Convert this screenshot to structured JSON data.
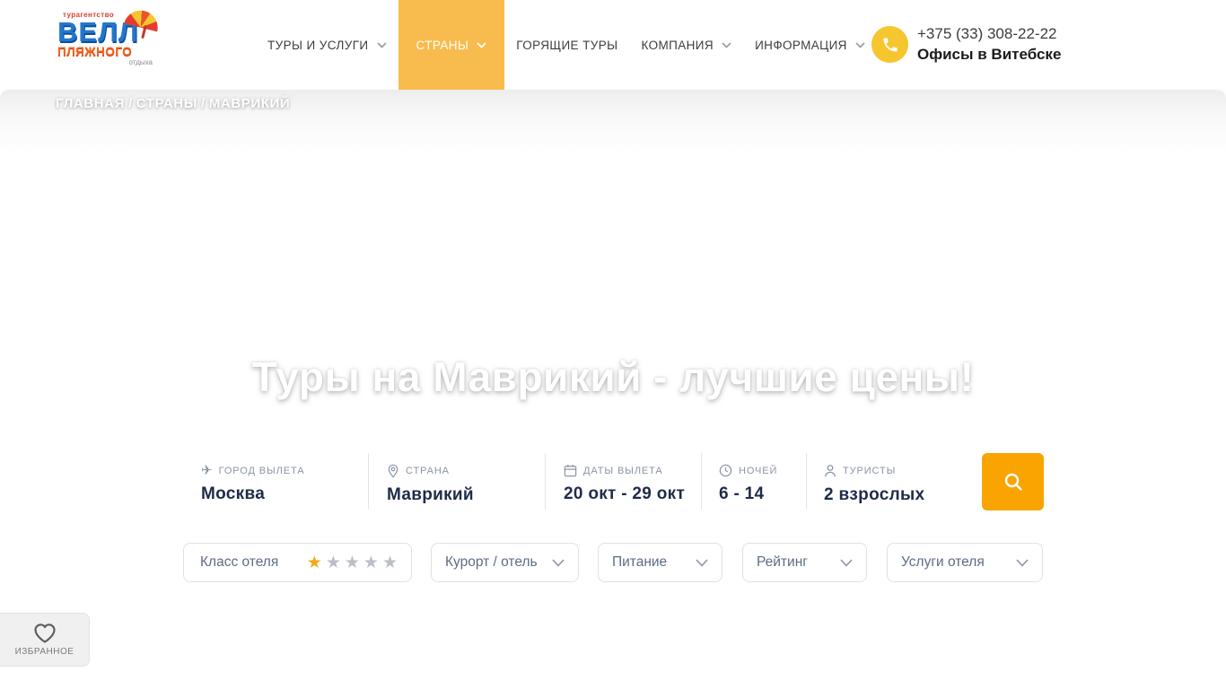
{
  "colors": {
    "accent_yellow": "#F8BC4E",
    "accent_orange": "#F9A400",
    "phone_circle_yellow": "#F6C62E",
    "star_active": "#F5A71B",
    "value_navy": "#1F2B49",
    "label_gray_blue": "#8A94A6"
  },
  "header": {
    "logo": {
      "agency": "турагентство",
      "brand": "ВЕЛЛ",
      "beach": "ПЛЯЖНОГО",
      "rest": "отдыха"
    },
    "nav": [
      {
        "label": "ТУРЫ И УСЛУГИ",
        "has_dropdown": true,
        "active": false
      },
      {
        "label": "СТРАНЫ",
        "has_dropdown": true,
        "active": true
      },
      {
        "label": "ГОРЯЩИЕ ТУРЫ",
        "has_dropdown": false,
        "active": false
      },
      {
        "label": "КОМПАНИЯ",
        "has_dropdown": true,
        "active": false
      },
      {
        "label": "ИНФОРМАЦИЯ",
        "has_dropdown": true,
        "active": false
      }
    ],
    "phone": "+375 (33) 308-22-22",
    "offices": "Офисы в Витебске"
  },
  "breadcrumb": {
    "items": [
      "ГЛАВНАЯ",
      "СТРАНЫ",
      "МАВРИКИЙ"
    ],
    "separator": "/"
  },
  "hero": {
    "title": "Туры на Маврикий - лучшие цены!"
  },
  "search": {
    "fields": [
      {
        "icon": "plane-icon",
        "label": "ГОРОД ВЫЛЕТА",
        "value": "Москва"
      },
      {
        "icon": "pin-icon",
        "label": "СТРАНА",
        "value": "Маврикий"
      },
      {
        "icon": "calendar-icon",
        "label": "ДАТЫ ВЫЛЕТА",
        "value": "20 окт - 29 окт"
      },
      {
        "icon": "clock-icon",
        "label": "НОЧЕЙ",
        "value": "6 - 14"
      },
      {
        "icon": "user-icon",
        "label": "ТУРИСТЫ",
        "value": "2 взрослых"
      }
    ]
  },
  "filters": {
    "hotel_class_label": "Класс отеля",
    "star_glyph": "★",
    "stars_total": 5,
    "stars_active": 1,
    "dropdowns": [
      {
        "label": "Курорт / отель"
      },
      {
        "label": "Питание"
      },
      {
        "label": "Рейтинг"
      },
      {
        "label": "Услуги отеля"
      }
    ]
  },
  "favorites": {
    "label": "ИЗБРАННОЕ"
  }
}
